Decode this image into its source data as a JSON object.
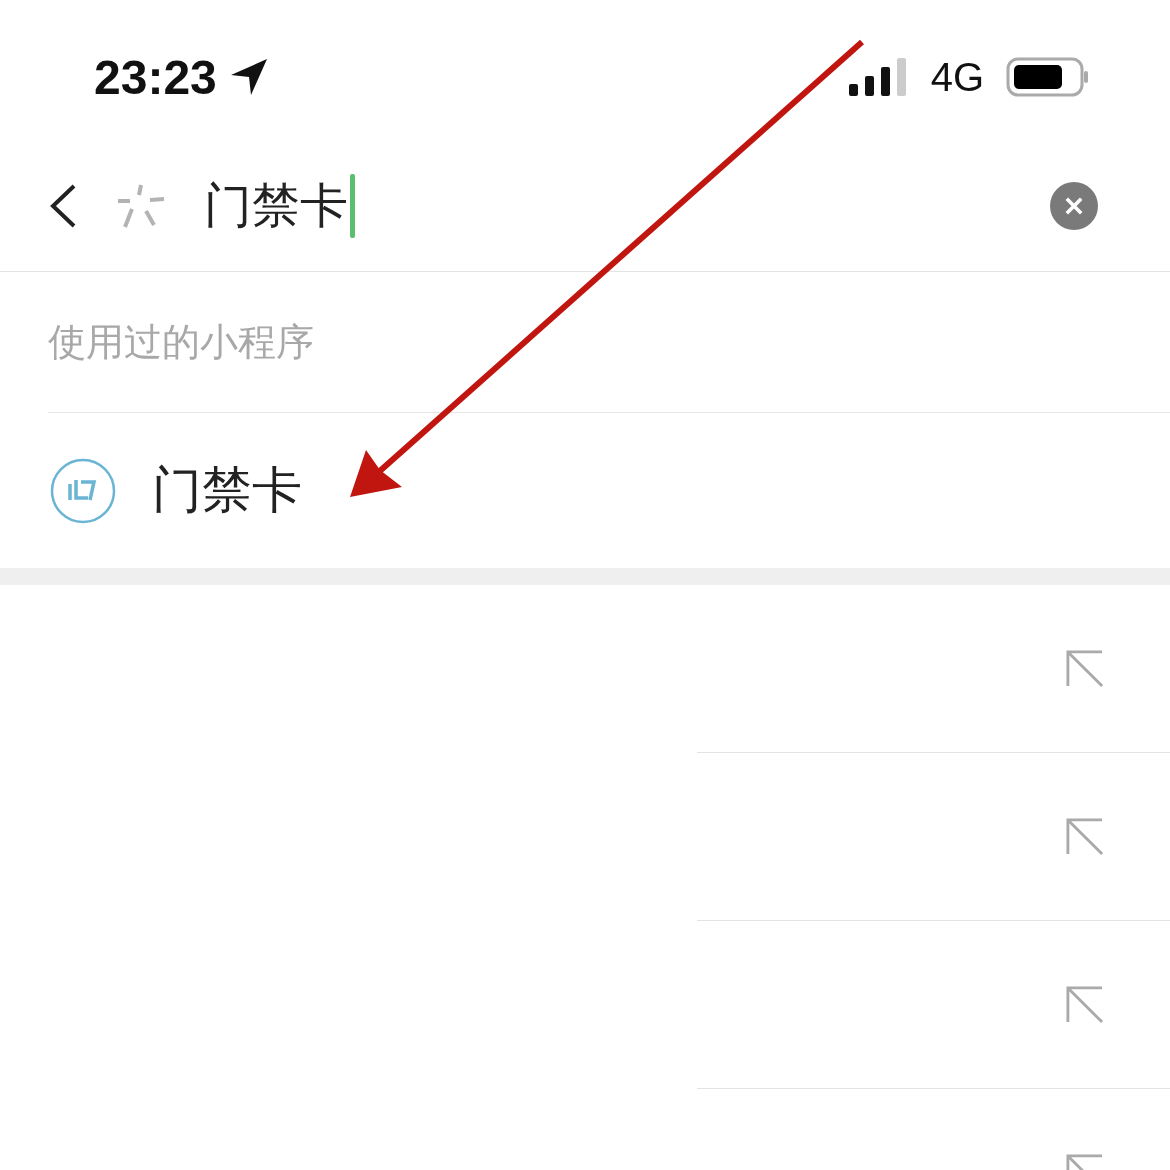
{
  "status_bar": {
    "time": "23:23",
    "network": "4G"
  },
  "search": {
    "value": "门禁卡"
  },
  "section": {
    "title": "使用过的小程序",
    "items": [
      {
        "name": "门禁卡"
      }
    ]
  }
}
